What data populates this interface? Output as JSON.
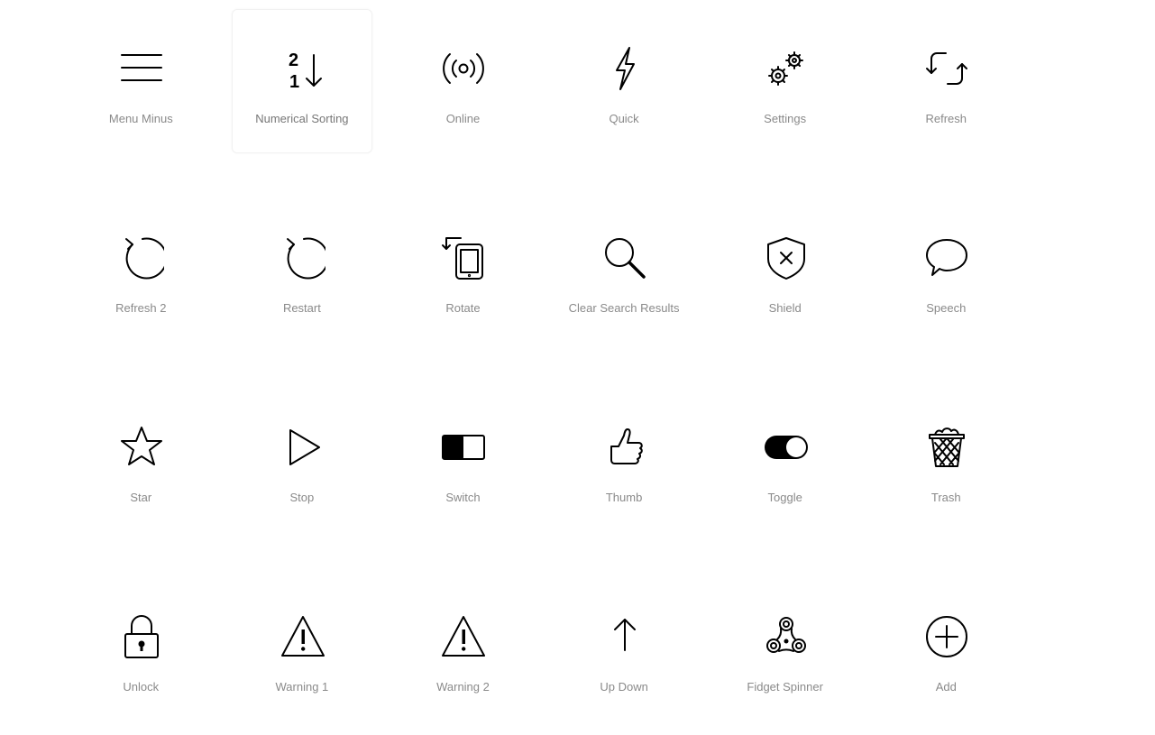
{
  "hovered_index": 1,
  "icons": [
    {
      "label": "Menu Minus",
      "icon": "menu-minus-icon"
    },
    {
      "label": "Numerical Sorting",
      "icon": "numerical-sorting-icon"
    },
    {
      "label": "Online",
      "icon": "online-icon"
    },
    {
      "label": "Quick",
      "icon": "quick-icon"
    },
    {
      "label": "Settings",
      "icon": "settings-icon"
    },
    {
      "label": "Refresh",
      "icon": "refresh-icon"
    },
    {
      "label": "Refresh 2",
      "icon": "refresh-2-icon"
    },
    {
      "label": "Restart",
      "icon": "restart-icon"
    },
    {
      "label": "Rotate",
      "icon": "rotate-icon"
    },
    {
      "label": "Clear Search Results",
      "icon": "clear-search-results-icon"
    },
    {
      "label": "Shield",
      "icon": "shield-icon"
    },
    {
      "label": "Speech",
      "icon": "speech-icon"
    },
    {
      "label": "Star",
      "icon": "star-icon"
    },
    {
      "label": "Stop",
      "icon": "stop-icon"
    },
    {
      "label": "Switch",
      "icon": "switch-icon"
    },
    {
      "label": "Thumb",
      "icon": "thumb-icon"
    },
    {
      "label": "Toggle",
      "icon": "toggle-icon"
    },
    {
      "label": "Trash",
      "icon": "trash-icon"
    },
    {
      "label": "Unlock",
      "icon": "unlock-icon"
    },
    {
      "label": "Warning 1",
      "icon": "warning-1-icon"
    },
    {
      "label": "Warning 2",
      "icon": "warning-2-icon"
    },
    {
      "label": "Up Down",
      "icon": "up-down-icon"
    },
    {
      "label": "Fidget Spinner",
      "icon": "fidget-spinner-icon"
    },
    {
      "label": "Add",
      "icon": "add-icon"
    }
  ]
}
